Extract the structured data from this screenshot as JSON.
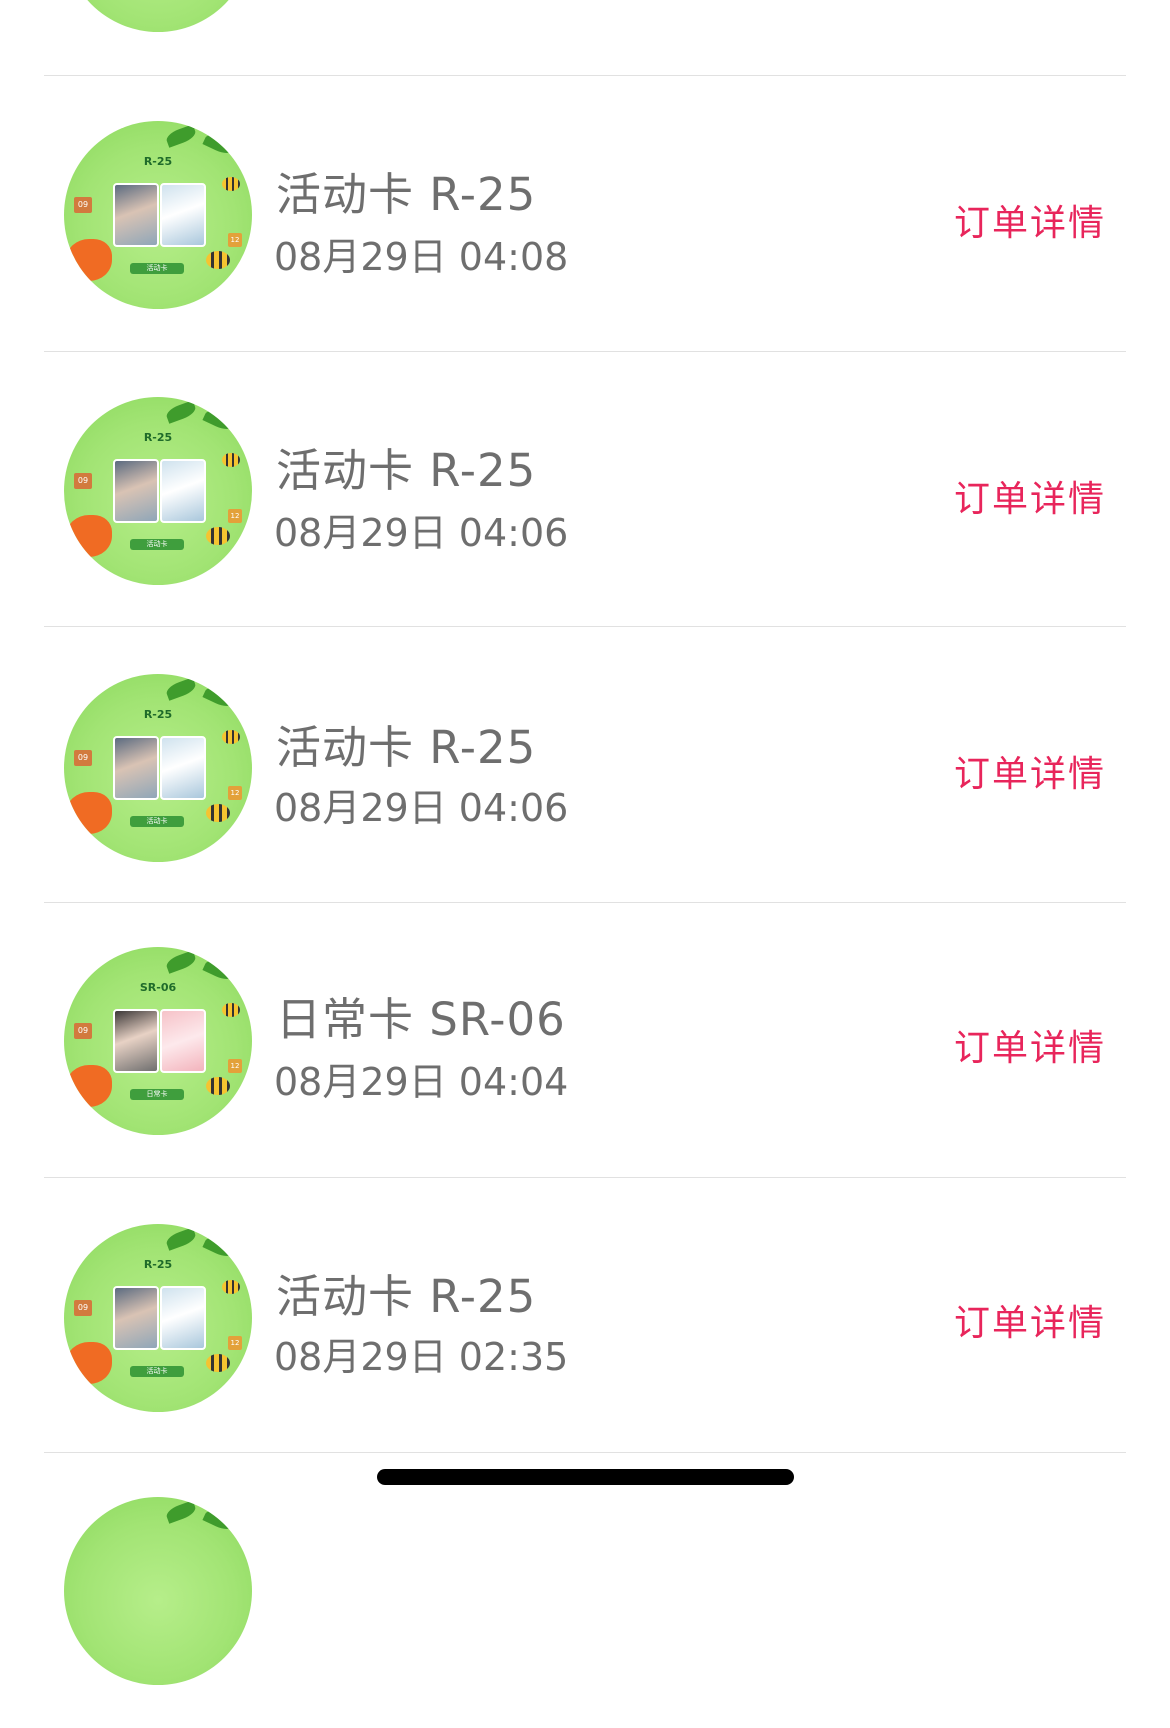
{
  "orders": [
    {
      "title": "活动卡 R-25",
      "time": "08月29日 04:08",
      "action": "订单详情",
      "code": "R-25",
      "tag": "活动卡"
    },
    {
      "title": "活动卡 R-25",
      "time": "08月29日 04:06",
      "action": "订单详情",
      "code": "R-25",
      "tag": "活动卡"
    },
    {
      "title": "活动卡 R-25",
      "time": "08月29日 04:06",
      "action": "订单详情",
      "code": "R-25",
      "tag": "活动卡"
    },
    {
      "title": "日常卡 SR-06",
      "time": "08月29日 04:04",
      "action": "订单详情",
      "code": "SR-06",
      "tag": "日常卡"
    },
    {
      "title": "活动卡 R-25",
      "time": "08月29日 02:35",
      "action": "订单详情",
      "code": "R-25",
      "tag": "活动卡"
    }
  ],
  "thumb_labels": {
    "num_left": "09",
    "num_right": "12"
  },
  "colors": {
    "accent": "#e8255b",
    "text": "#6e6e6e",
    "divider": "#e1e1e1"
  }
}
